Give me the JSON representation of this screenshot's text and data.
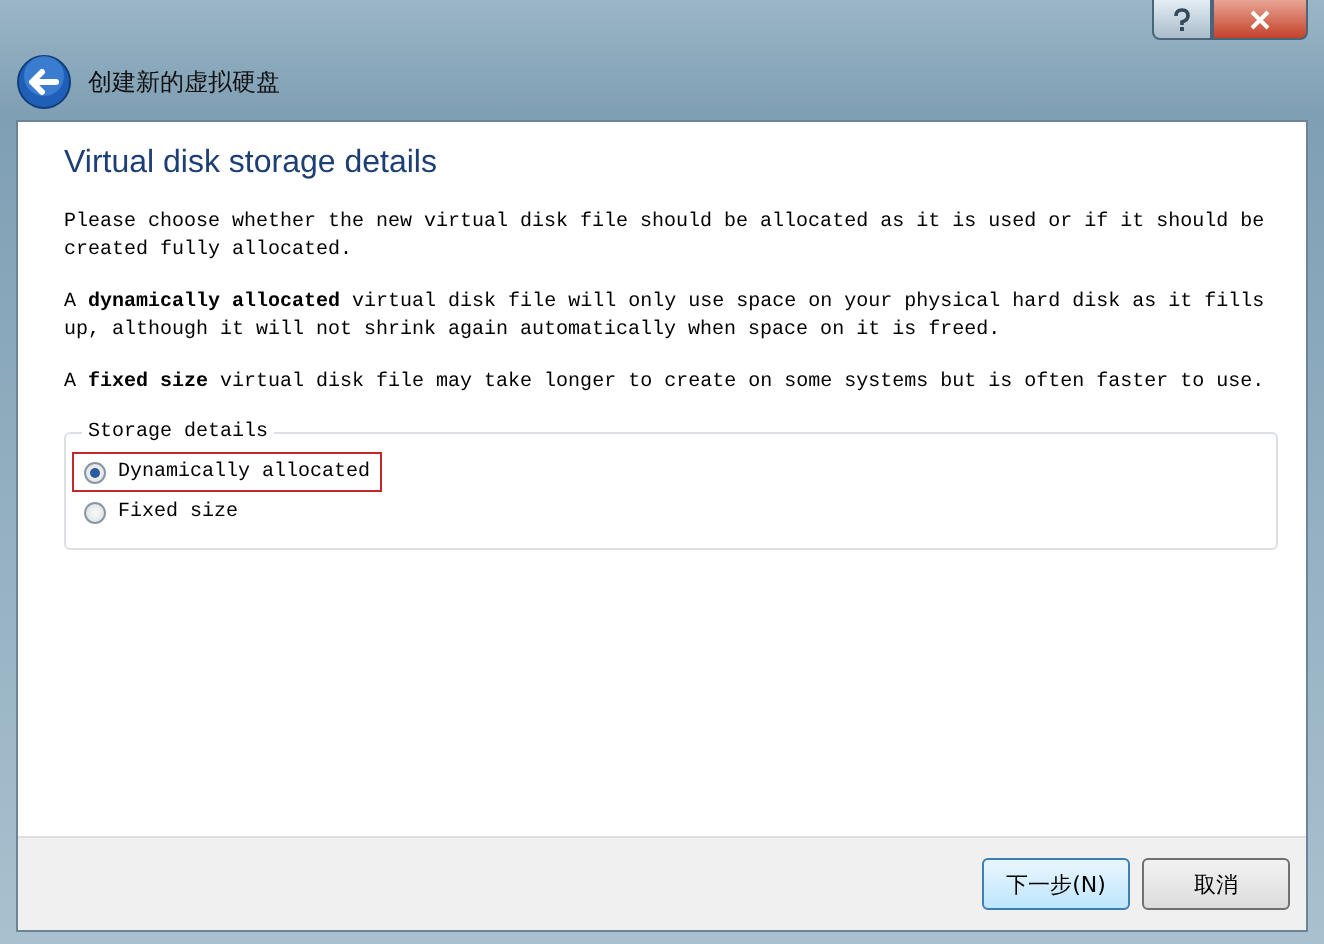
{
  "window": {
    "title": "创建新的虚拟硬盘"
  },
  "page": {
    "heading": "Virtual disk storage details",
    "paragraphs": [
      "Please choose whether the new virtual disk file should be allocated as it is used or if it should be created fully allocated.",
      "A **dynamically allocated** virtual disk file will only use space on your physical hard disk as it fills up, although it will not shrink again automatically when space on it is freed.",
      "A **fixed size** virtual disk file may take longer to create on some systems but is often faster to use."
    ]
  },
  "storage": {
    "legend": "Storage details",
    "options": [
      {
        "label": "Dynamically allocated",
        "selected": true,
        "highlighted": true
      },
      {
        "label": "Fixed size",
        "selected": false,
        "highlighted": false
      }
    ]
  },
  "buttons": [
    {
      "label": "下一步(N)",
      "default": true
    },
    {
      "label": "取消",
      "default": false
    }
  ]
}
